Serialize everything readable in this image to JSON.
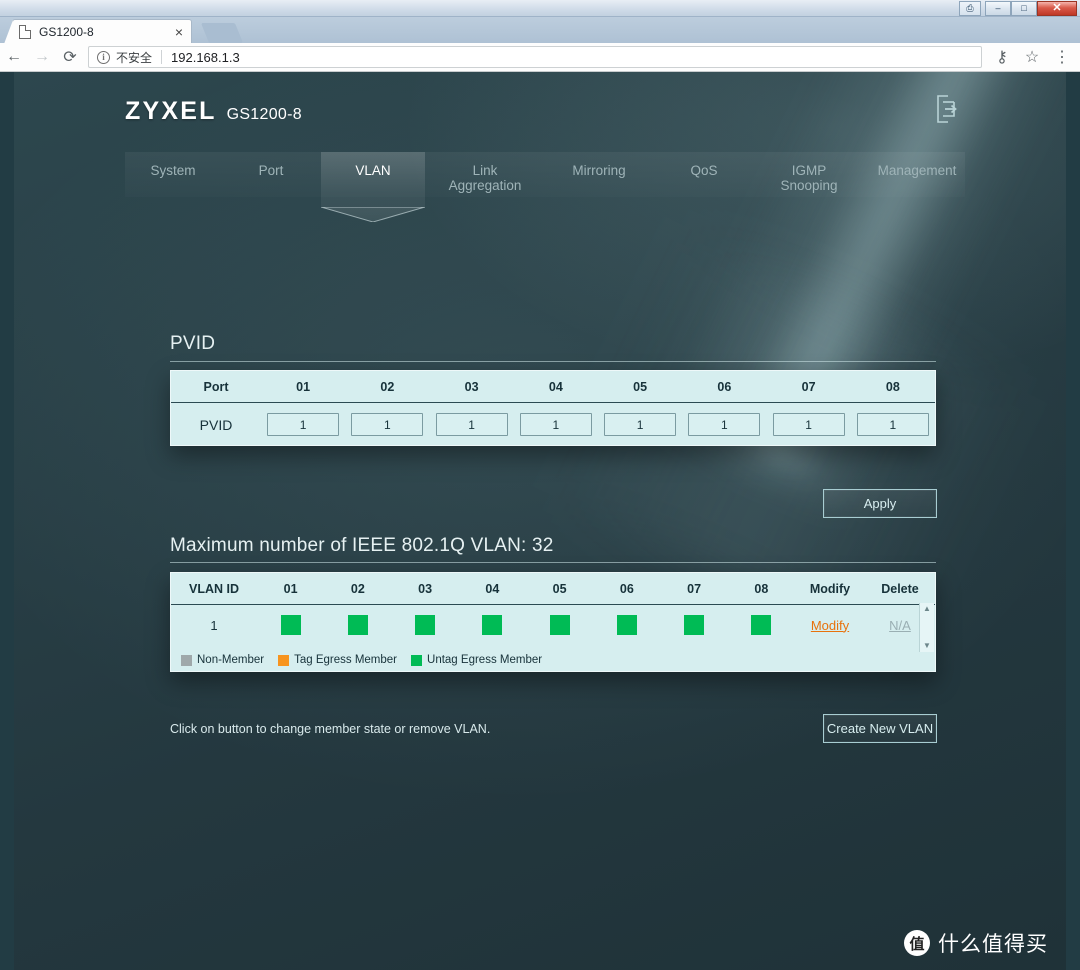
{
  "browser": {
    "tab_title": "GS1200-8",
    "tab_close": "×",
    "back_icon": "←",
    "forward_icon": "→",
    "reload_icon": "⟳",
    "info_icon": "i",
    "insecure_label": "不安全",
    "url": "192.168.1.3",
    "key_icon": "⚷",
    "star_icon": "☆",
    "menu_icon": "⋮",
    "minimize_label": "–",
    "maximize_label": "□",
    "close_label": "✕",
    "extra_label": "⎙"
  },
  "header": {
    "brand": "ZYXEL",
    "model": "GS1200-8",
    "logout_icon": "logout-icon"
  },
  "nav": {
    "tabs": [
      {
        "label": "System",
        "active": false
      },
      {
        "label": "Port",
        "active": false
      },
      {
        "label": "VLAN",
        "active": true
      },
      {
        "label": "Link\nAggregation",
        "active": false
      },
      {
        "label": "Mirroring",
        "active": false
      },
      {
        "label": "QoS",
        "active": false
      },
      {
        "label": "IGMP\nSnooping",
        "active": false
      },
      {
        "label": "Management",
        "active": false
      }
    ]
  },
  "pvid_section": {
    "title": "PVID",
    "row_header_port": "Port",
    "row_header_pvid": "PVID",
    "ports": [
      "01",
      "02",
      "03",
      "04",
      "05",
      "06",
      "07",
      "08"
    ],
    "values": [
      "1",
      "1",
      "1",
      "1",
      "1",
      "1",
      "1",
      "1"
    ],
    "apply_label": "Apply"
  },
  "vlan_section": {
    "title": "Maximum number of IEEE 802.1Q VLAN: 32",
    "columns": [
      "VLAN ID",
      "01",
      "02",
      "03",
      "04",
      "05",
      "06",
      "07",
      "08",
      "Modify",
      "Delete"
    ],
    "rows": [
      {
        "vlan_id": "1",
        "members": [
          "untag",
          "untag",
          "untag",
          "untag",
          "untag",
          "untag",
          "untag",
          "untag"
        ],
        "modify_label": "Modify",
        "delete_label": "N/A"
      }
    ],
    "legend": [
      {
        "label": "Non-Member",
        "color": "#9fa8aa"
      },
      {
        "label": "Tag Egress Member",
        "color": "#f7941e"
      },
      {
        "label": "Untag Egress Member",
        "color": "#00bb55"
      }
    ],
    "scroll_up": "▲",
    "scroll_down": "▼",
    "hint": "Click on button to change member state or remove VLAN.",
    "create_label": "Create New VLAN"
  },
  "watermark": {
    "badge": "值",
    "text": "什么值得买"
  },
  "colors": {
    "accent_green": "#00bb55",
    "accent_orange": "#e8720c",
    "panel_bg": "#d6eeef",
    "page_dark": "#24383f"
  }
}
